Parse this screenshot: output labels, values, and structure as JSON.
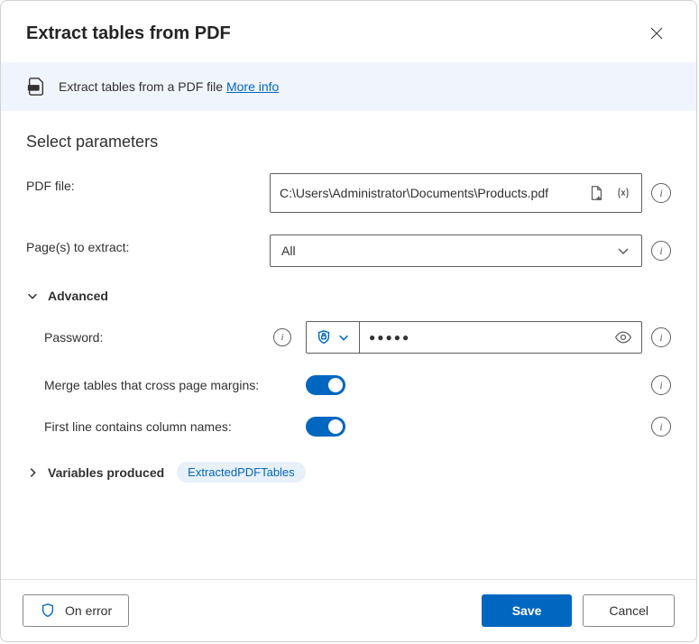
{
  "header": {
    "title": "Extract tables from PDF"
  },
  "banner": {
    "description": "Extract tables from a PDF file",
    "more_info": "More info"
  },
  "section": {
    "title": "Select parameters"
  },
  "params": {
    "pdf_file": {
      "label": "PDF file:",
      "value": "C:\\Users\\Administrator\\Documents\\Products.pdf"
    },
    "pages": {
      "label": "Page(s) to extract:",
      "value": "All"
    }
  },
  "advanced": {
    "label": "Advanced",
    "password": {
      "label": "Password:",
      "masked": "●●●●●"
    },
    "merge": {
      "label": "Merge tables that cross page margins:"
    },
    "first_line": {
      "label": "First line contains column names:"
    }
  },
  "variables": {
    "label": "Variables produced",
    "items": [
      "ExtractedPDFTables"
    ]
  },
  "footer": {
    "on_error": "On error",
    "save": "Save",
    "cancel": "Cancel"
  }
}
